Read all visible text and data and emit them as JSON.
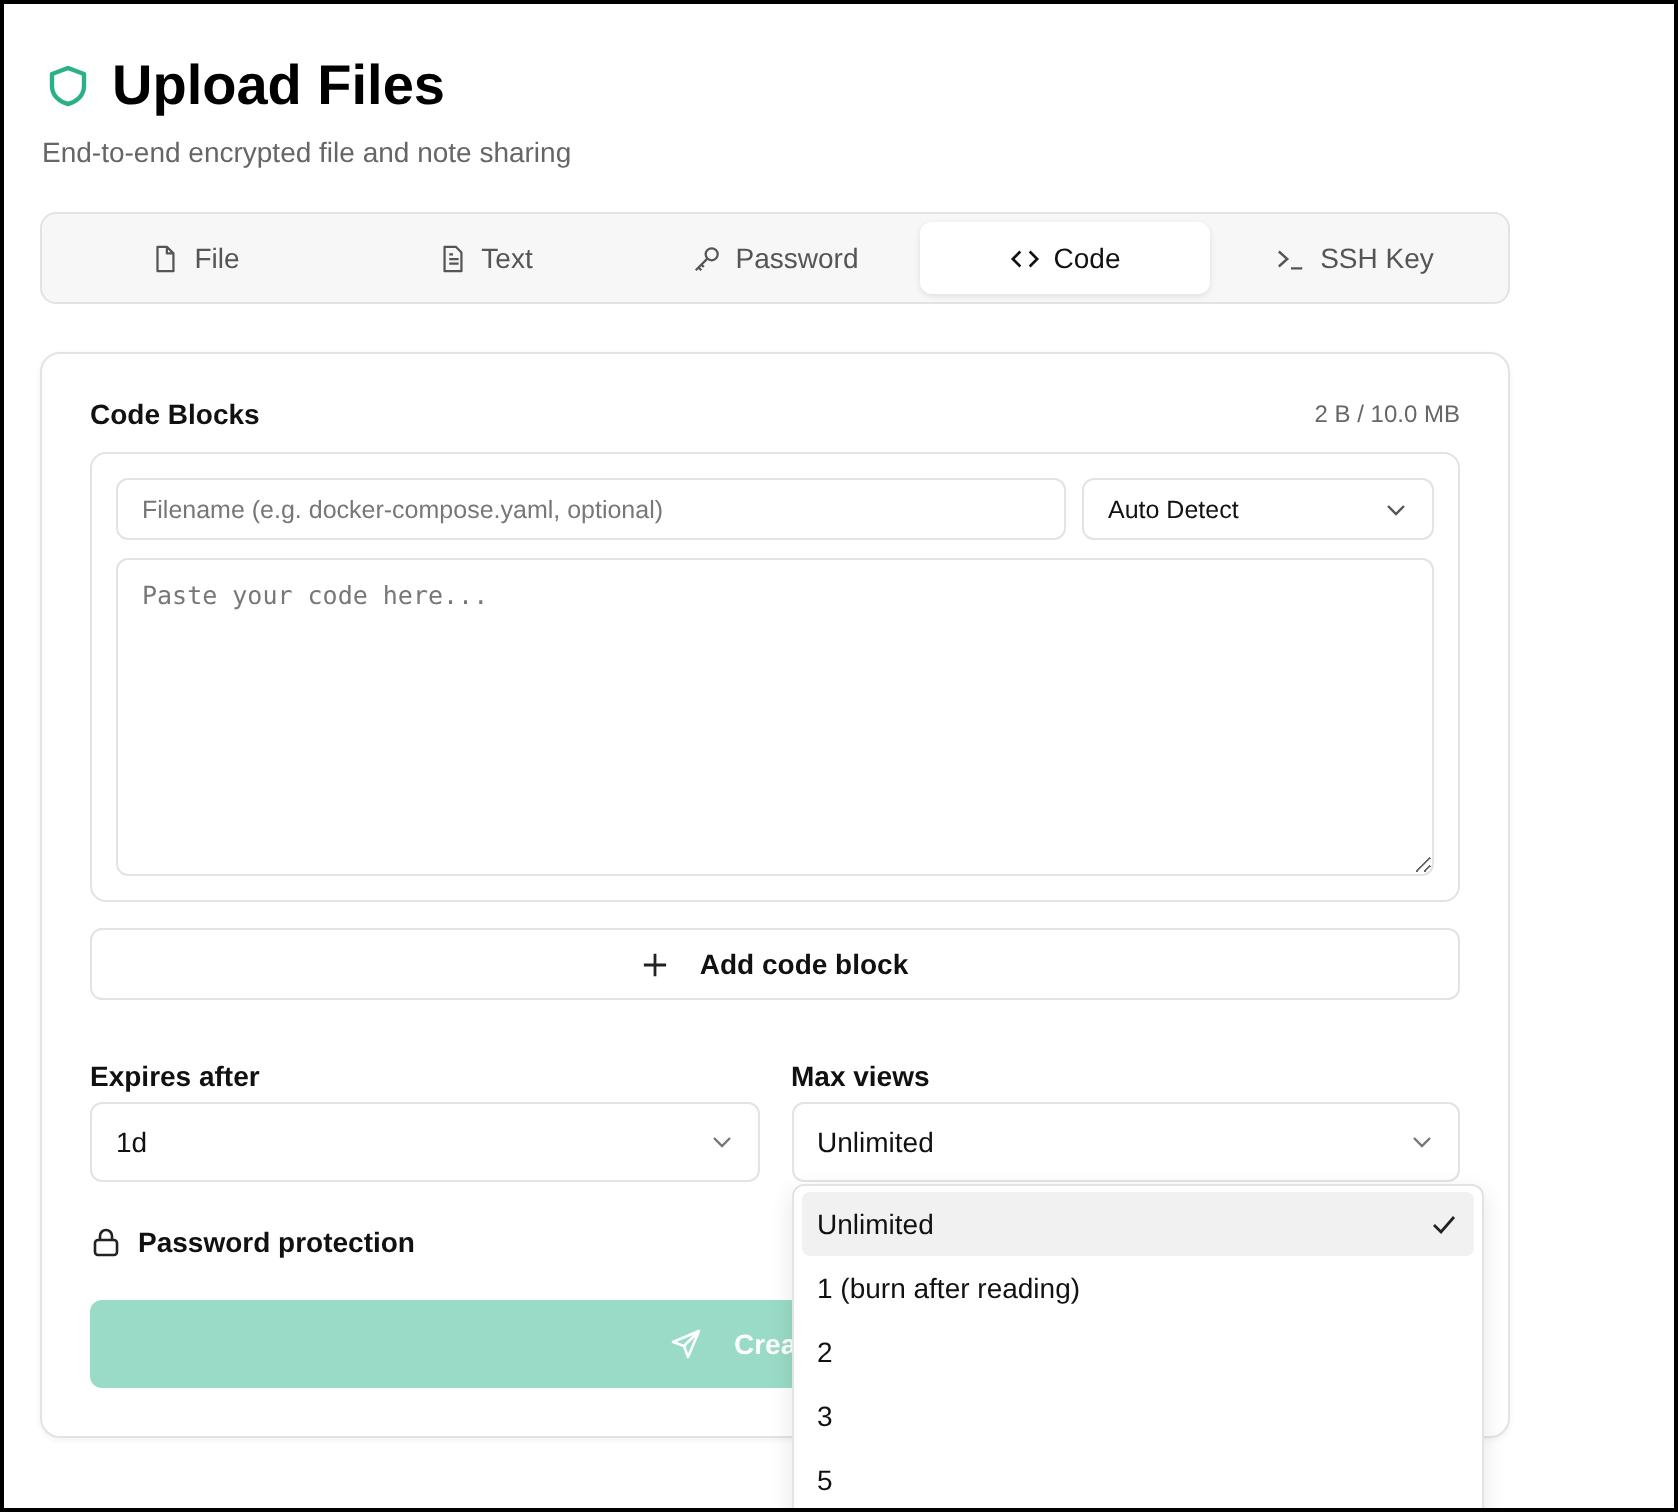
{
  "header": {
    "title": "Upload Files",
    "subtitle": "End-to-end encrypted file and note sharing"
  },
  "tabs": [
    {
      "label": "File",
      "kind": "file",
      "selected": false
    },
    {
      "label": "Text",
      "kind": "text",
      "selected": false
    },
    {
      "label": "Password",
      "kind": "password",
      "selected": false
    },
    {
      "label": "Code",
      "kind": "code",
      "selected": true
    },
    {
      "label": "SSH Key",
      "kind": "ssh",
      "selected": false
    }
  ],
  "code_blocks": {
    "label": "Code Blocks",
    "size": "2 B / 10.0 MB",
    "filename_placeholder": "Filename (e.g. docker-compose.yaml, optional)",
    "language": "Auto Detect",
    "code_placeholder": "Paste your code here...",
    "add_button": "Add code block"
  },
  "expires": {
    "label": "Expires after",
    "value": "1d"
  },
  "max_views": {
    "label": "Max views",
    "value": "Unlimited",
    "expanded": true,
    "options": [
      {
        "label": "Unlimited",
        "selected": true
      },
      {
        "label": "1 (burn after reading)",
        "selected": false
      },
      {
        "label": "2",
        "selected": false
      },
      {
        "label": "3",
        "selected": false
      },
      {
        "label": "5",
        "selected": false
      }
    ]
  },
  "password_protection": {
    "label": "Password protection"
  },
  "submit": {
    "label": "Crea",
    "disabled": true
  }
}
